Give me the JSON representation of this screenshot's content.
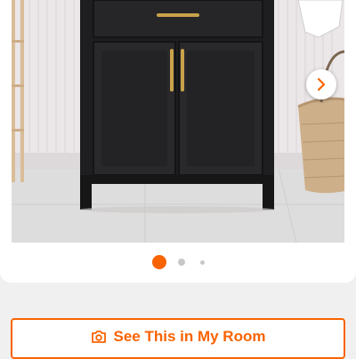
{
  "product_gallery": {
    "image_description_icon": "vanity-photo",
    "next_icon": "chevron-right-icon",
    "slide_count": 3,
    "active_slide": 1
  },
  "actions": {
    "see_in_room_label": "See This in My Room",
    "see_in_room_icon": "camera-icon"
  },
  "colors": {
    "accent": "#f96302",
    "dot_inactive": "#c8c8c8",
    "vanity": "#1e1e20",
    "hardware": "#c9a24a"
  }
}
